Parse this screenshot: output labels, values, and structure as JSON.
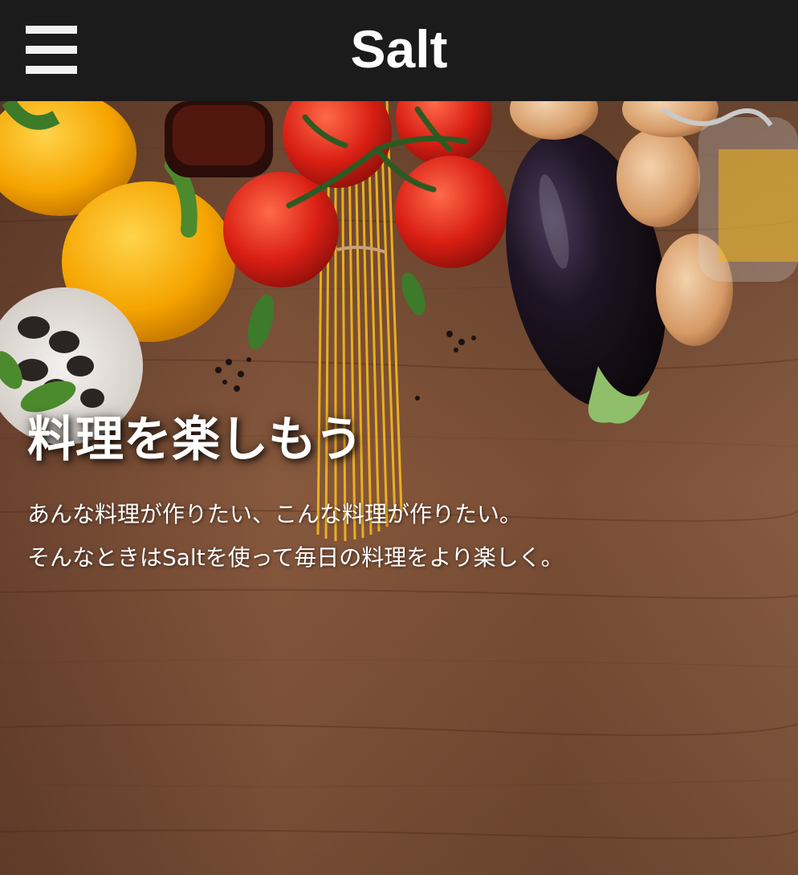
{
  "header": {
    "menu_icon": "hamburger-menu-icon",
    "brand": "Salt"
  },
  "hero": {
    "title": "料理を楽しもう",
    "lines": [
      "あんな料理が作りたい、こんな料理が作りたい。",
      "そんなときはSaltを使って毎日の料理をより楽しく。"
    ],
    "image": "vegetables-on-wooden-table-image"
  },
  "colors": {
    "header_bg": "#1b1b1b",
    "wood": "#8a5a3c",
    "text": "#ffffff"
  }
}
